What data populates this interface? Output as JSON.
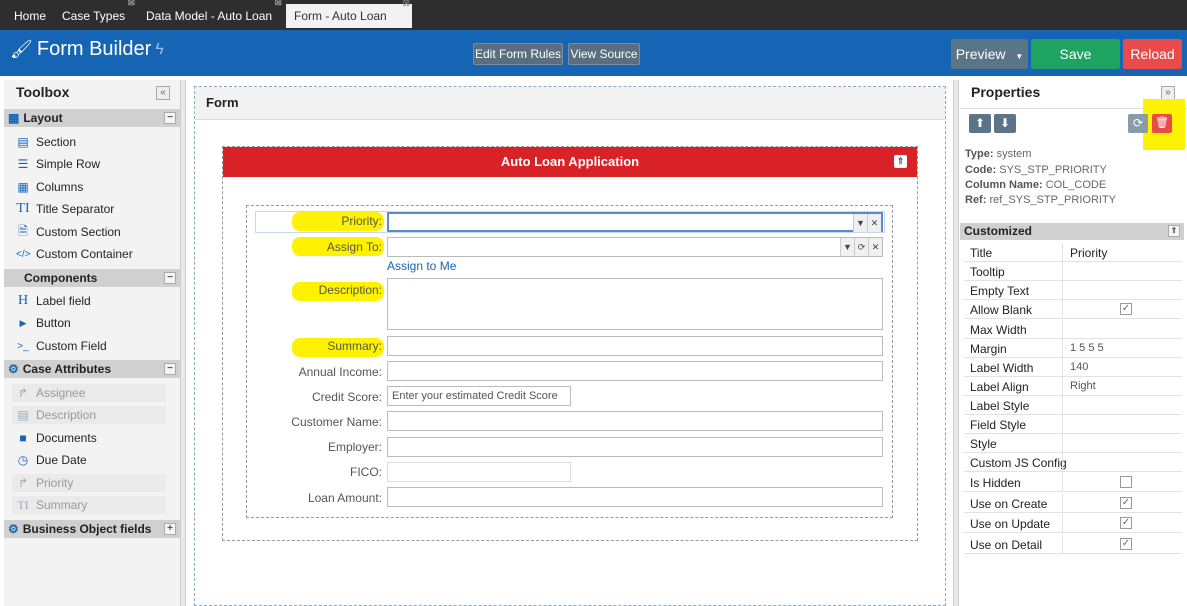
{
  "tabs": [
    {
      "label": "Home",
      "closable": false,
      "active": false
    },
    {
      "label": "Case Types",
      "closable": true,
      "active": false
    },
    {
      "label": "Data Model - Auto Loan",
      "closable": true,
      "active": false
    },
    {
      "label": "Form - Auto Loan",
      "closable": true,
      "active": true
    }
  ],
  "header": {
    "title": "Form Builder",
    "edit_form_rules": "Edit Form Rules",
    "view_source": "View Source",
    "preview": "Preview",
    "save": "Save",
    "reload": "Reload",
    "colors": {
      "bar": "#1565b4",
      "save": "#1ea363",
      "reload": "#e94b4b",
      "preview": "#5a7587"
    }
  },
  "toolbox": {
    "title": "Toolbox",
    "layout": {
      "label": "Layout",
      "items": [
        {
          "label": "Section",
          "icon": "section-icon"
        },
        {
          "label": "Simple Row",
          "icon": "rows-icon"
        },
        {
          "label": "Columns",
          "icon": "columns-icon"
        },
        {
          "label": "Title Separator",
          "icon": "title-icon"
        },
        {
          "label": "Custom Section",
          "icon": "code-file-icon"
        },
        {
          "label": "Custom Container",
          "icon": "code-icon"
        }
      ]
    },
    "components": {
      "label": "Components",
      "items": [
        {
          "label": "Label field",
          "icon": "heading-icon"
        },
        {
          "label": "Button",
          "icon": "caret-right-icon"
        },
        {
          "label": "Custom Field",
          "icon": "terminal-icon"
        }
      ]
    },
    "case_attributes": {
      "label": "Case Attributes",
      "items": [
        {
          "label": "Assignee",
          "icon": "share-icon",
          "disabled": true
        },
        {
          "label": "Description",
          "icon": "list-icon",
          "disabled": true
        },
        {
          "label": "Documents",
          "icon": "folder-icon",
          "disabled": false
        },
        {
          "label": "Due Date",
          "icon": "clock-icon",
          "disabled": false
        },
        {
          "label": "Priority",
          "icon": "share-icon",
          "disabled": true
        },
        {
          "label": "Summary",
          "icon": "title-icon",
          "disabled": true
        }
      ]
    },
    "business_object_fields": {
      "label": "Business Object fields"
    }
  },
  "form": {
    "title": "Form",
    "section_title": "Auto Loan Application",
    "fields": [
      {
        "label": "Priority:",
        "type": "combo",
        "highlighted": true,
        "value": "",
        "placeholder": ""
      },
      {
        "label": "Assign To:",
        "type": "combo-refresh",
        "highlighted": true,
        "value": "",
        "placeholder": ""
      },
      {
        "label": "Description:",
        "type": "textarea",
        "highlighted": true,
        "value": "",
        "placeholder": ""
      },
      {
        "label": "Summary:",
        "type": "text",
        "highlighted": true,
        "value": "",
        "placeholder": ""
      },
      {
        "label": "Annual Income:",
        "type": "text",
        "highlighted": false,
        "value": "",
        "placeholder": ""
      },
      {
        "label": "Credit Score:",
        "type": "text-short",
        "highlighted": false,
        "value": "",
        "placeholder": "Enter your estimated Credit Score"
      },
      {
        "label": "Customer Name:",
        "type": "text",
        "highlighted": false,
        "value": "",
        "placeholder": ""
      },
      {
        "label": "Employer:",
        "type": "text",
        "highlighted": false,
        "value": "",
        "placeholder": ""
      },
      {
        "label": "FICO:",
        "type": "text-short-disabled",
        "highlighted": false,
        "value": "",
        "placeholder": ""
      },
      {
        "label": "Loan Amount:",
        "type": "text",
        "highlighted": false,
        "value": "",
        "placeholder": ""
      }
    ],
    "assign_to_me": "Assign to Me"
  },
  "properties": {
    "title": "Properties",
    "meta": {
      "type_label": "Type:",
      "type": "system",
      "code_label": "Code:",
      "code": "SYS_STP_PRIORITY",
      "column_label": "Column Name:",
      "column": "COL_CODE",
      "ref_label": "Ref:",
      "ref": "ref_SYS_STP_PRIORITY"
    },
    "section_label": "Customized",
    "rows": [
      {
        "key": "Title",
        "value": "Priority"
      },
      {
        "key": "Tooltip",
        "value": ""
      },
      {
        "key": "Empty Text",
        "value": ""
      },
      {
        "key": "Allow Blank",
        "check": true
      },
      {
        "key": "Max Width",
        "value": ""
      },
      {
        "key": "Margin",
        "value": "1 5 5 5"
      },
      {
        "key": "Label Width",
        "value": "140"
      },
      {
        "key": "Label Align",
        "value": "Right"
      },
      {
        "key": "Label Style",
        "value": ""
      },
      {
        "key": "Field Style",
        "value": ""
      },
      {
        "key": "Style",
        "value": ""
      },
      {
        "key": "Custom JS Config",
        "value": ""
      },
      {
        "key": "Is Hidden",
        "check": false
      },
      {
        "key": "Use on Create",
        "check": true
      },
      {
        "key": "Use on Update",
        "check": true
      },
      {
        "key": "Use on Detail",
        "check": true
      }
    ]
  }
}
